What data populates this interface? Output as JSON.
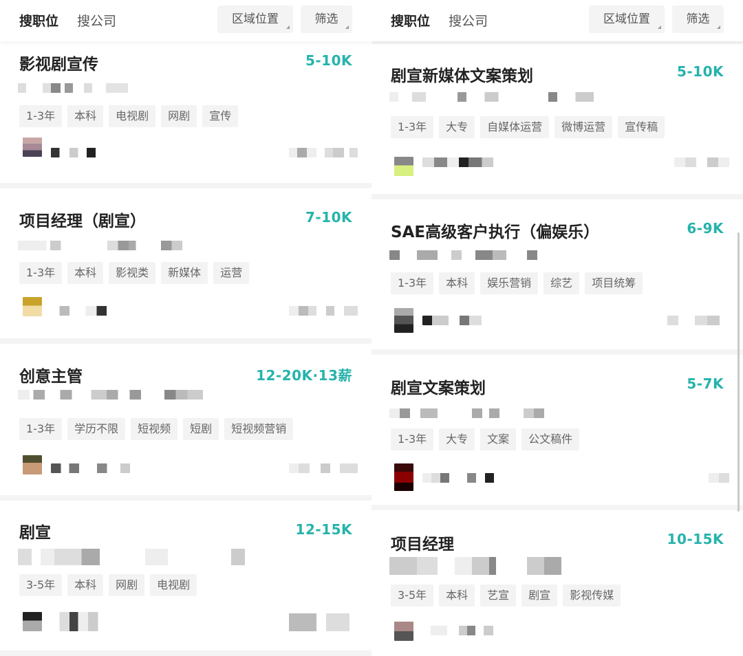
{
  "search_tabs": {
    "job_label": "搜职位",
    "company_label": "搜公司"
  },
  "filters": {
    "area_label": "区域位置",
    "filter_label": "筛选"
  },
  "left_cards": [
    {
      "title": "影视剧宣传",
      "salary": "5-10K",
      "tags": [
        "1-3年",
        "本科",
        "电视剧",
        "网剧",
        "宣传"
      ]
    },
    {
      "title": "项目经理（剧宣）",
      "salary": "7-10K",
      "tags": [
        "1-3年",
        "本科",
        "影视类",
        "新媒体",
        "运营"
      ]
    },
    {
      "title": "创意主管",
      "salary": "12-20K·13薪",
      "tags": [
        "1-3年",
        "学历不限",
        "短视频",
        "短剧",
        "短视频营销"
      ]
    },
    {
      "title": "剧宣",
      "salary": "12-15K",
      "tags": [
        "3-5年",
        "本科",
        "网剧",
        "电视剧"
      ]
    }
  ],
  "right_cards": [
    {
      "title": "剧宣新媒体文案策划",
      "salary": "5-10K",
      "tags": [
        "1-3年",
        "大专",
        "自媒体运营",
        "微博运营",
        "宣传稿"
      ]
    },
    {
      "title": "SAE高级客户执行（偏娱乐）",
      "salary": "6-9K",
      "tags": [
        "1-3年",
        "本科",
        "娱乐营销",
        "综艺",
        "项目统筹"
      ]
    },
    {
      "title": "剧宣文案策划",
      "salary": "5-7K",
      "tags": [
        "1-3年",
        "大专",
        "文案",
        "公文稿件"
      ]
    },
    {
      "title": "项目经理",
      "salary": "10-15K",
      "tags": [
        "3-5年",
        "本科",
        "艺宣",
        "剧宣",
        "影视传媒"
      ]
    }
  ],
  "colors": {
    "salary": "#26b3ab",
    "tag_bg": "#f3f3f3",
    "page_bg": "#f4f4f4"
  },
  "icons": {
    "filter_corner": "corner-triangle-icon",
    "avatar": "avatar-icon"
  }
}
